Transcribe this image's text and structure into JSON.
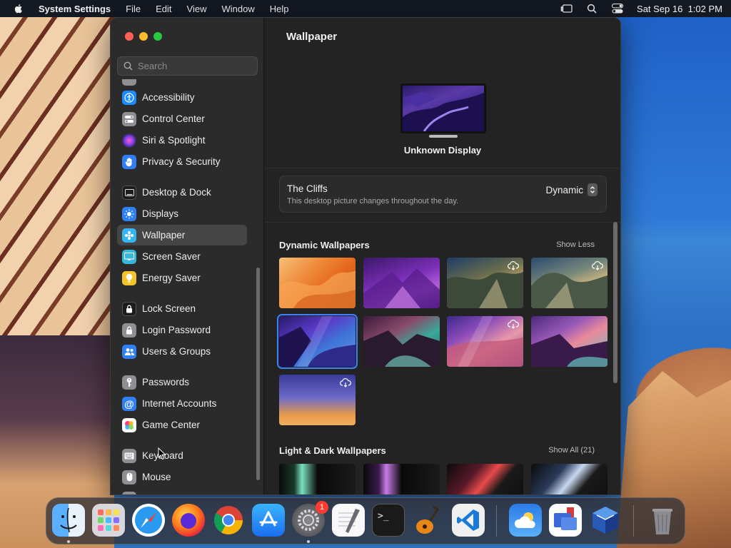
{
  "menubar": {
    "app_name": "System Settings",
    "menus": [
      "File",
      "Edit",
      "View",
      "Window",
      "Help"
    ],
    "clock": "Sat Sep 16  1:02 PM"
  },
  "window": {
    "title": "Wallpaper",
    "search": {
      "placeholder": "Search",
      "value": ""
    },
    "sidebar": {
      "items": [
        {
          "label": "Accessibility",
          "icon": "accessibility-icon",
          "color": "#1a8cff"
        },
        {
          "label": "Control Center",
          "icon": "control-center-icon",
          "color": "#8e8e93"
        },
        {
          "label": "Siri & Spotlight",
          "icon": "siri-icon",
          "color": "#b04bd6"
        },
        {
          "label": "Privacy & Security",
          "icon": "hand-icon",
          "color": "#2f7ff7"
        },
        {
          "label": "Desktop & Dock",
          "icon": "desktop-dock-icon",
          "color": "#1c1c1e"
        },
        {
          "label": "Displays",
          "icon": "displays-icon",
          "color": "#2f7ff7"
        },
        {
          "label": "Wallpaper",
          "icon": "wallpaper-icon",
          "color": "#35b6f0"
        },
        {
          "label": "Screen Saver",
          "icon": "screen-saver-icon",
          "color": "#36b8d8"
        },
        {
          "label": "Energy Saver",
          "icon": "bulb-icon",
          "color": "#f5c22a"
        },
        {
          "label": "Lock Screen",
          "icon": "lock-screen-icon",
          "color": "#1c1c1e"
        },
        {
          "label": "Login Password",
          "icon": "lock-icon",
          "color": "#8e8e93"
        },
        {
          "label": "Users & Groups",
          "icon": "users-icon",
          "color": "#2f7ff7"
        },
        {
          "label": "Passwords",
          "icon": "key-icon",
          "color": "#8e8e93"
        },
        {
          "label": "Internet Accounts",
          "icon": "at-icon",
          "color": "#2f7ff7"
        },
        {
          "label": "Game Center",
          "icon": "game-center-icon",
          "color": "#ffffff"
        },
        {
          "label": "Keyboard",
          "icon": "keyboard-icon",
          "color": "#8e8e93"
        },
        {
          "label": "Mouse",
          "icon": "mouse-icon",
          "color": "#8e8e93"
        }
      ],
      "selected": "Wallpaper"
    },
    "display_name": "Unknown Display",
    "current_wallpaper": {
      "name": "The Cliffs",
      "description": "This desktop picture changes throughout the day.",
      "mode": "Dynamic"
    },
    "sections": {
      "dynamic": {
        "title": "Dynamic Wallpapers",
        "action": "Show Less"
      },
      "light_dark": {
        "title": "Light & Dark Wallpapers",
        "action": "Show All (21)"
      }
    }
  },
  "dock": {
    "apps": [
      "Finder",
      "Launchpad",
      "Safari",
      "Firefox",
      "Chrome",
      "App Store",
      "System Settings",
      "TextEdit",
      "Terminal",
      "GarageBand",
      "Visual Studio Code",
      "Weather",
      "Remote Desktop",
      "VirtualBox",
      "Trash"
    ],
    "settings_badge": "1"
  }
}
